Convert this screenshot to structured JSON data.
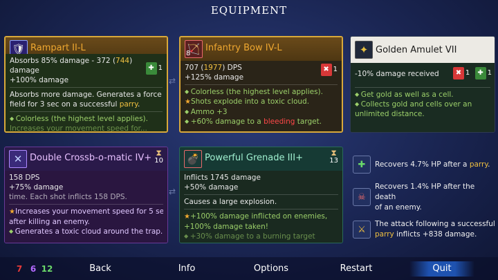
{
  "screen_title": "EQUIPMENT",
  "cards": {
    "rampart": {
      "name": "Rampart II-L",
      "icon": "shield-icon",
      "lines": [
        "Absorbs 85% damage - 372 (744)",
        "damage",
        "+100% damage"
      ],
      "scroll_count": "1",
      "desc": [
        "Absorbs more damage. Generates a force",
        "field for 3 sec on a successful parry."
      ],
      "affixes": [
        "Colorless (the highest level applies).",
        "Increases your movement speed for..."
      ]
    },
    "bow": {
      "name": "Infantry Bow IV-L",
      "icon": "bow-icon",
      "level": "8",
      "lines": [
        "707 (1977) DPS",
        "+125% damage"
      ],
      "scroll_count": "1",
      "affixes": [
        "Colorless (the highest level applies).",
        "Shots explode into a toxic cloud.",
        "Ammo +3",
        "+60% damage to a bleeding target."
      ]
    },
    "amulet": {
      "name": "Golden Amulet VII",
      "icon": "amulet-icon",
      "lines": [
        "-10% damage received"
      ],
      "red_count": "1",
      "green_count": "1",
      "affixes": [
        "Get gold as well as a cell.",
        "Collects gold and cells over an",
        "unlimited distance."
      ]
    },
    "crossbow": {
      "name": "Double Crossb-o-matic IV+",
      "icon": "crossbow-icon",
      "cooldown": "10",
      "lines": [
        "158 DPS",
        "+75% damage"
      ],
      "desc": [
        "time. Each shot inflicts 158 DPS."
      ],
      "affixes": [
        "Increases your movement speed for 5 sec",
        "after killing an enemy.",
        "Generates a toxic cloud around the trap."
      ]
    },
    "grenade": {
      "name": "Powerful Grenade III+",
      "icon": "grenade-icon",
      "cooldown": "13",
      "lines": [
        "Inflicts 1745 damage",
        "+50% damage"
      ],
      "desc": [
        "Causes a large explosion."
      ],
      "affixes": [
        "+100% damage inflicted on enemies,",
        "+100% damage taken!",
        "+30% damage to a burning target"
      ]
    }
  },
  "mutations": [
    {
      "icon": "heal-icon",
      "text_a": "Recovers 4.7% HP after a ",
      "hl": "parry",
      "text_b": "."
    },
    {
      "icon": "kill-heal-icon",
      "text_a": "Recovers 1.4% HP after the death",
      "hl": "",
      "text_b": "of an enemy."
    },
    {
      "icon": "counter-icon",
      "text_a": "The attack following a successful",
      "hl": "parry",
      "text_b": " inflicts +838 damage."
    }
  ],
  "scrolls": {
    "brutality": "7",
    "tactics": "6",
    "survival": "12"
  },
  "colors": {
    "brutality": "#e83a3a",
    "tactics": "#b46aff",
    "survival": "#6ad86a"
  },
  "nav": {
    "back": "Back",
    "info": "Info",
    "options": "Options",
    "restart": "Restart",
    "quit": "Quit"
  }
}
